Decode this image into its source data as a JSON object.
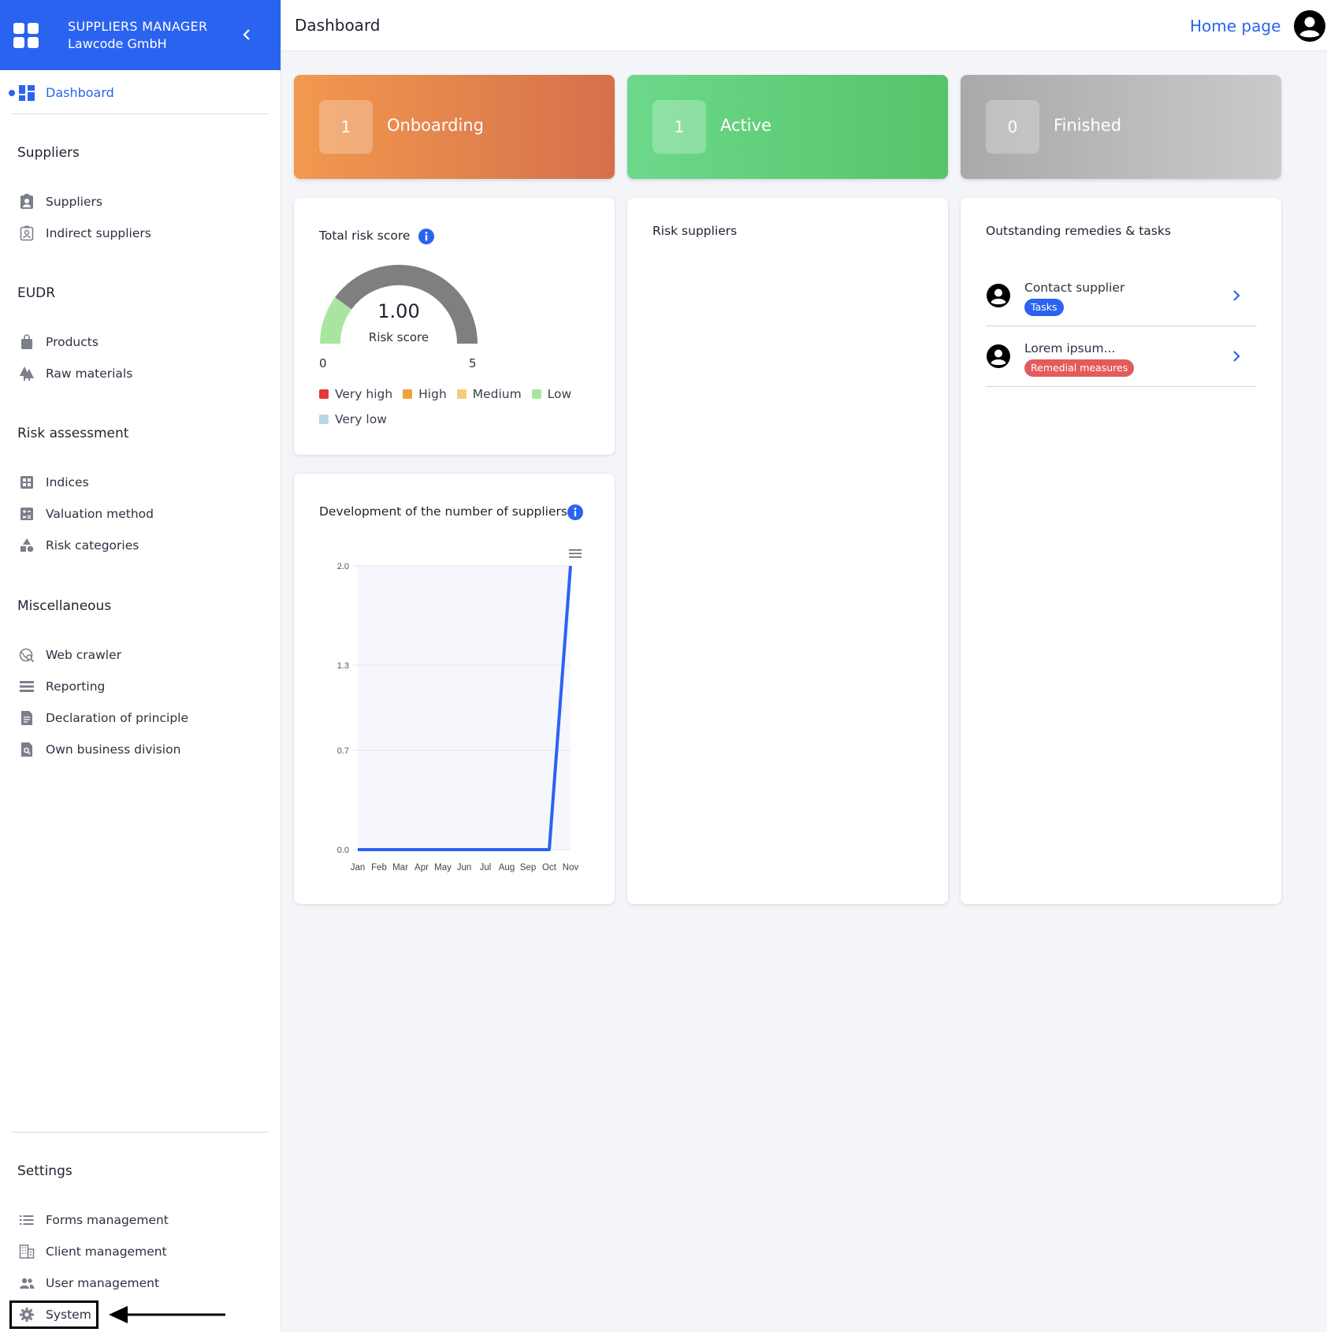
{
  "brand": {
    "title": "SUPPLIERS MANAGER",
    "company": "Lawcode GmbH"
  },
  "nav": {
    "dashboard": "Dashboard",
    "sections": [
      {
        "title": "Suppliers",
        "items": [
          "Suppliers",
          "Indirect suppliers"
        ]
      },
      {
        "title": "EUDR",
        "items": [
          "Products",
          "Raw materials"
        ]
      },
      {
        "title": "Risk assessment",
        "items": [
          "Indices",
          "Valuation method",
          "Risk categories"
        ]
      },
      {
        "title": "Miscellaneous",
        "items": [
          "Web crawler",
          "Reporting",
          "Declaration of principle",
          "Own business division"
        ]
      },
      {
        "title": "Settings",
        "items": [
          "Forms management",
          "Client management",
          "User management",
          "System"
        ]
      }
    ]
  },
  "header": {
    "title": "Dashboard",
    "home_link": "Home page"
  },
  "stats": [
    {
      "value": "1",
      "label": "Onboarding"
    },
    {
      "value": "1",
      "label": "Active"
    },
    {
      "value": "0",
      "label": "Finished"
    }
  ],
  "risk_score": {
    "title": "Total risk score",
    "value": "1.00",
    "value_label": "Risk score",
    "min": "0",
    "max": "5",
    "fraction": 0.2,
    "colors": {
      "filled": "#a8e6a0",
      "track": "#7f7f7f"
    },
    "legend": [
      {
        "label": "Very high",
        "color": "#e53935"
      },
      {
        "label": "High",
        "color": "#f0a23b"
      },
      {
        "label": "Medium",
        "color": "#f6c97c"
      },
      {
        "label": "Low",
        "color": "#a8e6a0"
      },
      {
        "label": "Very low",
        "color": "#b8d6e6"
      }
    ]
  },
  "risk_suppliers": {
    "title": "Risk suppliers"
  },
  "remedies": {
    "title": "Outstanding remedies & tasks",
    "items": [
      {
        "name": "Contact supplier",
        "badge": "Tasks",
        "badge_color": "#2b63f1"
      },
      {
        "name": "Lorem ipsum...",
        "badge": "Remedial measures",
        "badge_color": "#e45b5b"
      }
    ]
  },
  "chart_data": {
    "type": "line",
    "title": "Development of the number of suppliers",
    "categories": [
      "Jan",
      "Feb",
      "Mar",
      "Apr",
      "May",
      "Jun",
      "Jul",
      "Aug",
      "Sep",
      "Oct",
      "Nov"
    ],
    "series": [
      {
        "values": [
          0,
          0,
          0,
          0,
          0,
          0,
          0,
          0,
          0,
          0,
          2
        ]
      }
    ],
    "yticks": [
      "0.0",
      "0.7",
      "1.3",
      "2.0"
    ],
    "ylim": [
      0,
      2
    ],
    "color": "#2b63f1"
  }
}
